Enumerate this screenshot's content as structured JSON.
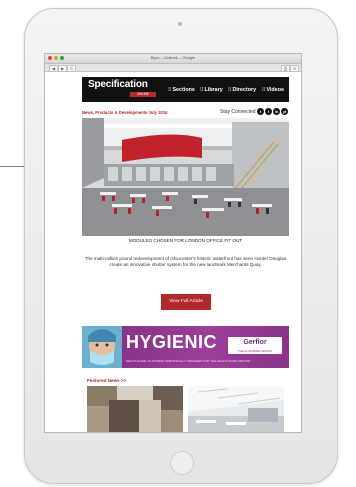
{
  "window": {
    "title": "Byco – Outlook – Google",
    "toolbar_buttons": [
      "◀",
      "▶",
      "↻",
      "⎙",
      "✕"
    ]
  },
  "brand": {
    "name": "Specification",
    "badge": "ONLINE"
  },
  "nav": {
    "items": [
      {
        "icon": "grid",
        "label": "Sections"
      },
      {
        "icon": "grid",
        "label": "Library"
      },
      {
        "icon": "grid",
        "label": "Directory"
      },
      {
        "icon": "grid",
        "label": "Videos"
      }
    ]
  },
  "newsletter": {
    "heading": "News, Products & Developments July 2016",
    "stay_connected": "Stay Connected",
    "social": [
      "t",
      "f",
      "in",
      "yt"
    ]
  },
  "article": {
    "caption": "MODULEO CHOSEN FOR LONDON OFFICE FIT OUT",
    "summary": "The multi-million pound redevelopment of Gloucester's historic waterfront has seen Hunter Douglas create an innovative shutter system for the new landmark Merchants Quay.",
    "button": "View Full Article"
  },
  "ad": {
    "headline": "HYGIENIC",
    "tagline": "HEALTHCARE | FLOORING SPECIFICALLY DESIGNED FOR THE HEALTHCARE SECTOR",
    "brand": "Gerflor",
    "brand_sub": "THE FLOORING GROUP"
  },
  "featured": {
    "heading": "Featured News >>"
  },
  "colors": {
    "accent": "#b1282b",
    "nav_bg": "#111111",
    "ad_bg": "#8a3388"
  }
}
